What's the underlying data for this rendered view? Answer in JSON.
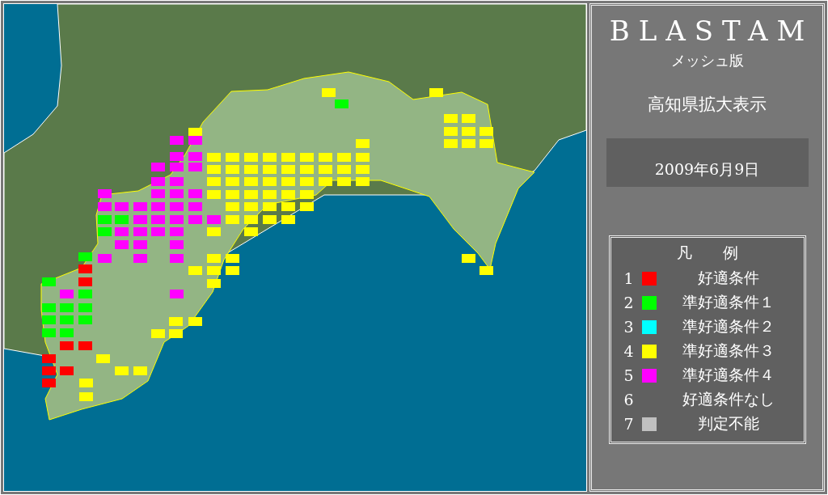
{
  "panel": {
    "title": "BLASTAM",
    "subtitle": "メッシュ版",
    "view": "高知県拡大表示",
    "date": "2009年6月9日"
  },
  "legend": {
    "title": "凡　　例",
    "items": [
      {
        "number": "1",
        "label": "好適条件",
        "color": "#ff0000"
      },
      {
        "number": "2",
        "label": "準好適条件１",
        "color": "#00ff00"
      },
      {
        "number": "3",
        "label": "準好適条件２",
        "color": "#00ffff"
      },
      {
        "number": "4",
        "label": "準好適条件３",
        "color": "#ffff00"
      },
      {
        "number": "5",
        "label": "準好適条件４",
        "color": "#ff00ff"
      },
      {
        "number": "6",
        "label": "好適条件なし"
      },
      {
        "number": "7",
        "label": "判定不能",
        "color": "#c0c0c0"
      }
    ]
  }
}
